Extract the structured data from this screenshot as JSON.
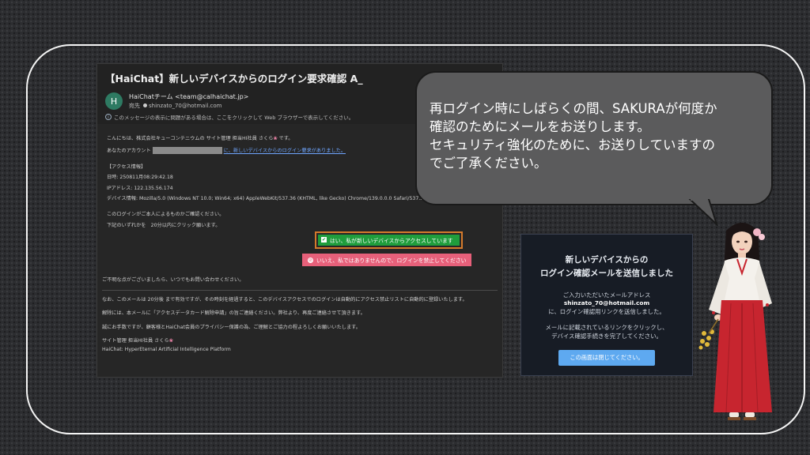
{
  "email": {
    "subject": "【HaiChat】新しいデバイスからのログイン要求確認 A_",
    "avatar_letter": "H",
    "sender": "HaiChatチーム <team@calhaichat.jp>",
    "to_label": "宛先",
    "to_address": "shinzato_70@hotmail.com",
    "info_notice": "このメッセージの表示に問題がある場合は、ここをクリックして Web ブラウザーで表示してください。",
    "greeting": "こんにちは、株式会社キューコンテニウムの サイト管理 担当HI社員 さくら",
    "greeting_end": " です。",
    "account_prefix": "あなたのアカウント",
    "account_link": "に、新しいデバイスからのログイン要求がありました。",
    "access_header": "【アクセス情報】",
    "datetime": "日時: 250811月08:29:42.18",
    "ip": "IPアドレス: 122.135.56.174",
    "device": "デバイス情報: Mozilla/5.0 (Windows NT 10.0; Win64; x64) AppleWebKit/537.36 (KHTML, like Gecko) Chrome/139.0.0.0 Safari/537.36",
    "confirm_line": "このログインがご本人によるものかご確認ください。",
    "click_line": "下記のいずれかを　20分以内にクリック願います。",
    "yes_button": "はい、私が新しいデバイスからアクセスしています",
    "no_button": "いいえ、私ではありませんので、ログインを禁止してください",
    "contact_line": "ご不明な点がございましたら、いつでもお問い合わせください。",
    "note1": "なお、このメールは 20分後 まで有効ですが、その時刻を経過すると、このデバイスアクセスでのログインは自動的にアクセス禁止リストに自動的に登録いたします。",
    "note2": "解除には、本メールに「アクセスデータカード解除申請」の旨ご連絡ください。弊社より、再度ご連絡させて頂きます。",
    "note3": "誠にお手数ですが、顧客様とHaiChat会員のプライバシー保護の為、ご理解とご協力の程よろしくお願いいたします。",
    "signature": "サイト管理 担当HI社員 さくら",
    "platform": "HaiChat: HyperEternal Artificial Intelligence Platform"
  },
  "bubble": {
    "line1": "再ログイン時にしばらくの間、SAKURAが何度か",
    "line2": "確認のためにメールをお送りします。",
    "line3": "セキュリティ強化のために、お送りしていますの",
    "line4": "でご了承ください。"
  },
  "card": {
    "title_line1": "新しいデバイスからの",
    "title_line2": "ログイン確認メールを送信しました",
    "text1": "ご入力いただいたメールアドレス",
    "email": "shinzato_70@hotmail.com",
    "text2": "に、ログイン確認用リンクを送信しました。",
    "text3": "メールに記載されているリンクをクリックし、",
    "text4": "デバイス確認手続きを完了してください。",
    "close_button": "この画面は閉じてください。"
  },
  "colors": {
    "yes_green": "#1f9d3c",
    "no_pink": "#e7607a",
    "highlight_orange": "#d57a2c",
    "card_button_blue": "#5ea9f0",
    "bubble_gray": "#5b5b5c"
  },
  "icons": [
    "info-icon",
    "check-icon",
    "ban-icon",
    "flower-icon"
  ]
}
